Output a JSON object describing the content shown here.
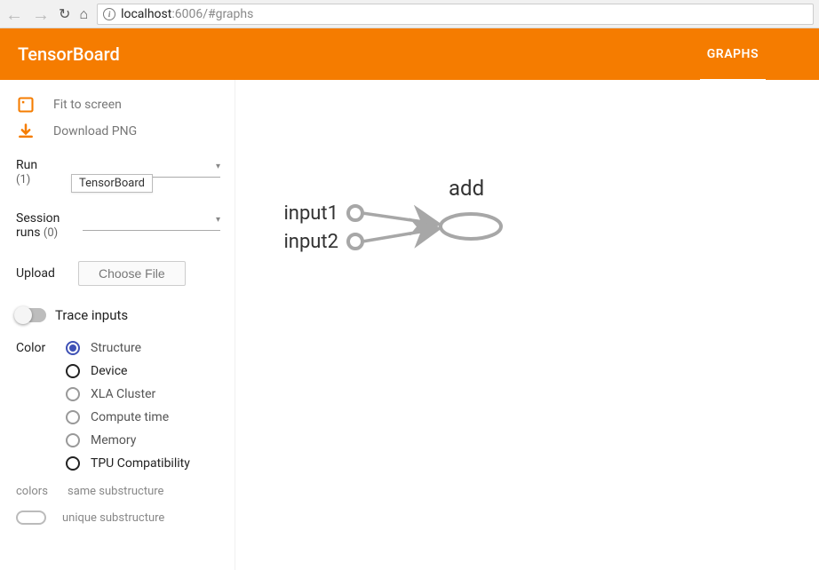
{
  "browser": {
    "url_host": "localhost",
    "url_port_path": ":6006/#graphs"
  },
  "header": {
    "title": "TensorBoard",
    "active_tab": "GRAPHS"
  },
  "sidebar": {
    "fit_label": "Fit to screen",
    "download_label": "Download PNG",
    "run_label": "Run",
    "run_count": "(1)",
    "run_tooltip": "TensorBoard",
    "session_label_l1": "Session",
    "session_label_l2": "runs",
    "session_count": "(0)",
    "upload_label": "Upload",
    "choose_file_label": "Choose File",
    "trace_label": "Trace inputs",
    "color_label": "Color",
    "color_options": {
      "structure": "Structure",
      "device": "Device",
      "xla": "XLA Cluster",
      "compute": "Compute time",
      "memory": "Memory",
      "tpu": "TPU Compatibility"
    },
    "legend_colors_label": "colors",
    "legend_same": "same substructure",
    "legend_unique": "unique substructure"
  },
  "graph": {
    "input1": "input1",
    "input2": "input2",
    "op": "add"
  }
}
